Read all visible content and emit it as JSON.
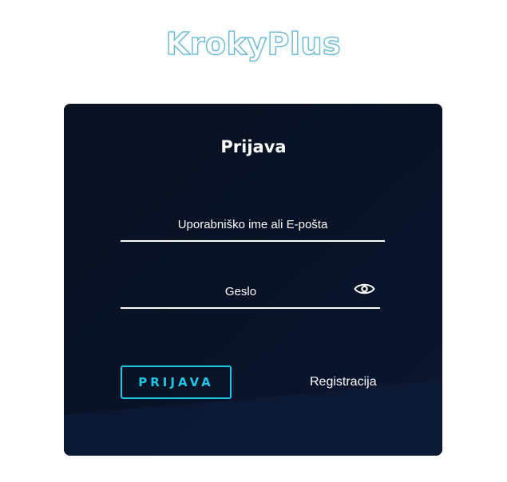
{
  "header": {
    "logo_text": "KrokyPlus"
  },
  "login_card": {
    "title": "Prijava",
    "username_label": "Uporabniško ime ali E-pošta",
    "password_label": "Geslo",
    "show_password_icon": "eye-icon",
    "login_button_label": "PRIJAVA",
    "register_link_label": "Registracija"
  },
  "colors": {
    "card_background": "#081226",
    "accent": "#1ec8e4",
    "logo": "#8fd0e4",
    "text": "#ffffff"
  }
}
